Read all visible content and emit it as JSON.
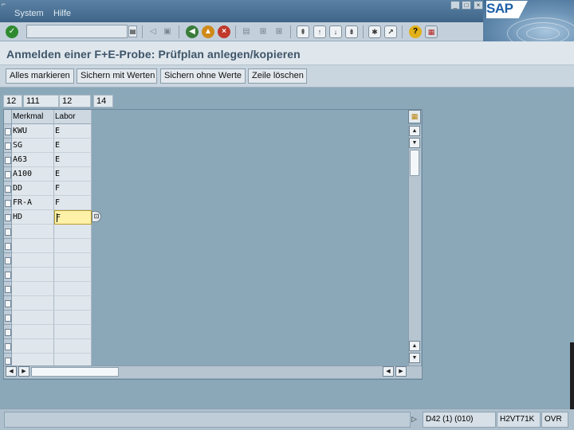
{
  "menubar": {
    "items": [
      "System",
      "Hilfe"
    ]
  },
  "logo": {
    "text": "SAP"
  },
  "toolbar": {
    "command_field_value": "",
    "icons": [
      "ok-icon",
      "save-icon",
      "back-icon",
      "exit-icon",
      "cancel-icon",
      "print-icon",
      "find-icon",
      "find-next-icon",
      "first-page-icon",
      "previous-page-icon",
      "next-page-icon",
      "last-page-icon",
      "new-session-icon",
      "shortcut-icon",
      "help-icon",
      "layout-menu-icon"
    ]
  },
  "title": {
    "text": "Anmelden einer F+E-Probe: Prüfplan anlegen/kopieren"
  },
  "app_toolbar": {
    "buttons": [
      "Alles markieren",
      "Sichern mit Werten",
      "Sichern ohne Werte",
      "Zeile löschen"
    ]
  },
  "header_fields": [
    "12",
    "111",
    "12",
    "14"
  ],
  "table": {
    "columns": [
      "Merkmal",
      "Labor"
    ],
    "rows": [
      {
        "merkmal": "KWU",
        "labor": "E"
      },
      {
        "merkmal": "SG",
        "labor": "E"
      },
      {
        "merkmal": "A63",
        "labor": "E"
      },
      {
        "merkmal": "A100",
        "labor": "E"
      },
      {
        "merkmal": "DD",
        "labor": "F"
      },
      {
        "merkmal": "FR-A",
        "labor": "F"
      },
      {
        "merkmal": "HD",
        "labor": "F"
      }
    ],
    "empty_rows": 10
  },
  "statusbar": {
    "message": "",
    "system": "D42 (1) (010)",
    "server": "H2VT71K",
    "mode": "OVR"
  },
  "colors": {
    "background": "#8ba8b9",
    "active_field": "#fff1a8",
    "title_text": "#3e5569"
  }
}
